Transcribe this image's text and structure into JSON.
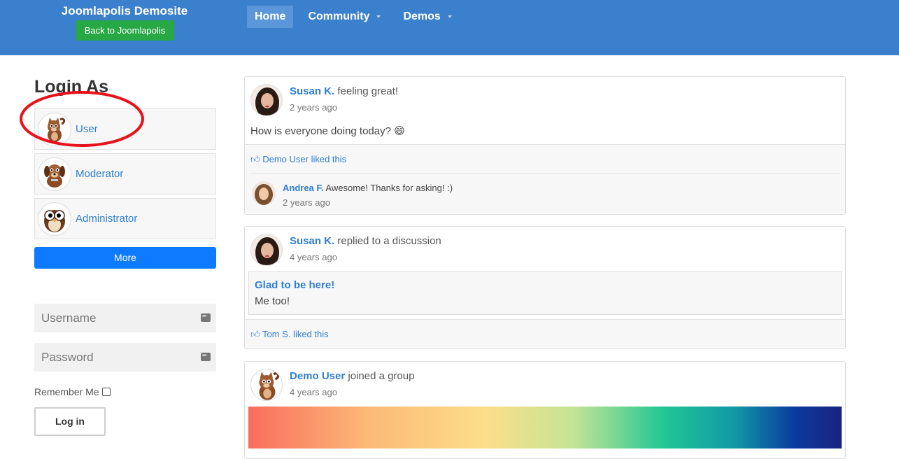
{
  "header": {
    "site_title": "Joomlapolis Demosite",
    "back_button": "Back to Joomlapolis",
    "nav": [
      {
        "label": "Home",
        "active": true
      },
      {
        "label": "Community",
        "dropdown": true
      },
      {
        "label": "Demos",
        "dropdown": true
      }
    ],
    "bg_color": "#3b80cc"
  },
  "login": {
    "title": "Login As",
    "users": [
      {
        "label": "User",
        "icon": "cat-avatar-icon"
      },
      {
        "label": "Moderator",
        "icon": "dog-avatar-icon"
      },
      {
        "label": "Administrator",
        "icon": "owl-avatar-icon"
      }
    ],
    "more_button": "More",
    "username_placeholder": "Username",
    "password_placeholder": "Password",
    "remember_label": "Remember Me",
    "login_button": "Log in"
  },
  "activity": [
    {
      "user": "Susan K.",
      "action": "feeling great!",
      "time": "2 years ago",
      "body": "How is everyone doing today? 😄",
      "likes": "Demo User liked this",
      "reply": {
        "user": "Andrea F.",
        "text": "Awesome! Thanks for asking! :)",
        "time": "2 years ago"
      }
    },
    {
      "user": "Susan K.",
      "action": "replied to a discussion",
      "time": "4 years ago",
      "quote_title": "Glad to be here!",
      "quote_text": "Me too!",
      "likes": "Tom S. liked this"
    },
    {
      "user": "Demo User",
      "action": "joined a group",
      "time": "4 years ago"
    }
  ],
  "colors": {
    "link": "#2f7ed4",
    "more_button": "#0d7aff",
    "back_button": "#28a745",
    "highlight": "#e8121c"
  }
}
